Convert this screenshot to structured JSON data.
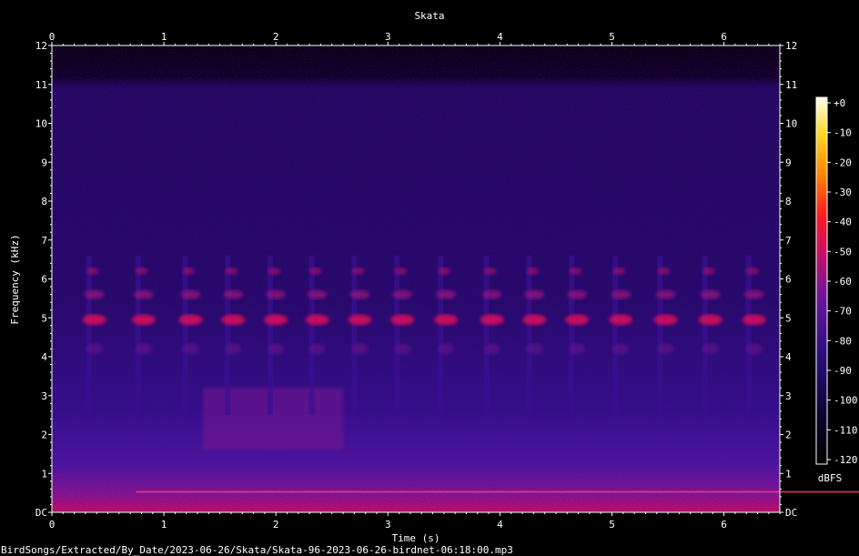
{
  "chart_data": {
    "type": "heatmap",
    "title": "Skata",
    "xlabel": "Time (s)",
    "ylabel": "Frequency (kHz)",
    "xlim": [
      0,
      6.5
    ],
    "ylim": [
      0,
      12
    ],
    "x_ticks": [
      "0",
      "1",
      "2",
      "3",
      "4",
      "5",
      "6"
    ],
    "y_ticks": [
      "DC",
      "1",
      "2",
      "3",
      "4",
      "5",
      "6",
      "7",
      "8",
      "9",
      "10",
      "11",
      "12"
    ],
    "colorbar": {
      "label": "dBFS",
      "range": [
        -120,
        0
      ],
      "ticks": [
        "+0",
        "-10",
        "-20",
        "-30",
        "-40",
        "-50",
        "-60",
        "-70",
        "-80",
        "-90",
        "-100",
        "-110",
        "-120"
      ]
    },
    "footer": "BirdSongs/Extracted/By_Date/2023-06-26/Skata/Skata-96-2023-06-26-birdnet-06:18:00.mp3",
    "calls_s": [
      0.33,
      0.77,
      1.19,
      1.57,
      1.95,
      2.32,
      2.7,
      3.08,
      3.47,
      3.88,
      4.26,
      4.64,
      5.03,
      5.43,
      5.83,
      6.22
    ]
  },
  "colors": {
    "background": "#000000",
    "low": "#0a0538",
    "mid": "#3a1aa8",
    "high": "#e0105a",
    "peak": "#ffffff"
  }
}
